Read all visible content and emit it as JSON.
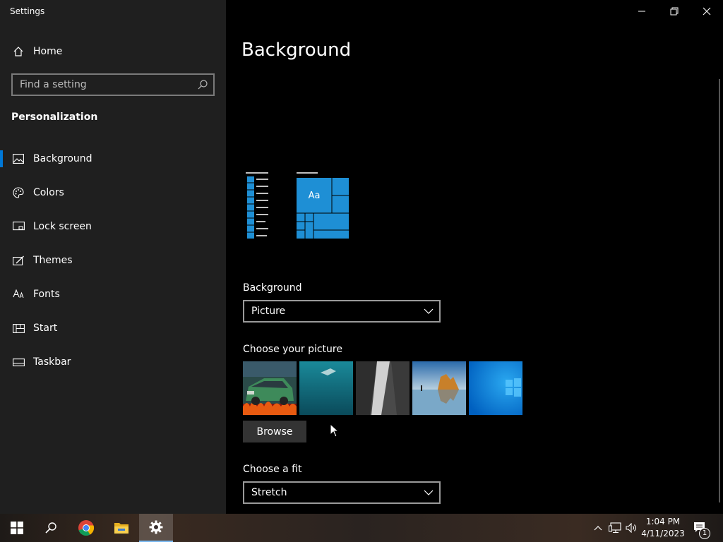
{
  "window": {
    "title": "Settings"
  },
  "sidebar": {
    "home_label": "Home",
    "search_placeholder": "Find a setting",
    "section_title": "Personalization",
    "items": [
      {
        "label": "Background",
        "icon": "image-icon",
        "active": true
      },
      {
        "label": "Colors",
        "icon": "palette-icon"
      },
      {
        "label": "Lock screen",
        "icon": "lock-screen-icon"
      },
      {
        "label": "Themes",
        "icon": "themes-icon"
      },
      {
        "label": "Fonts",
        "icon": "fonts-icon"
      },
      {
        "label": "Start",
        "icon": "start-icon"
      },
      {
        "label": "Taskbar",
        "icon": "taskbar-icon"
      }
    ]
  },
  "main": {
    "title": "Background",
    "preview": {
      "tile_text": "Aa"
    },
    "background_label": "Background",
    "background_value": "Picture",
    "choose_picture_label": "Choose your picture",
    "browse_label": "Browse",
    "fit_label": "Choose a fit",
    "fit_value": "Stretch"
  },
  "taskbar": {
    "time": "1:04 PM",
    "date": "4/11/2023",
    "notification_count": "1"
  },
  "colors": {
    "accent": "#0078d7",
    "tile": "#1e8fd5",
    "sidebar": "#1f1f1f"
  }
}
